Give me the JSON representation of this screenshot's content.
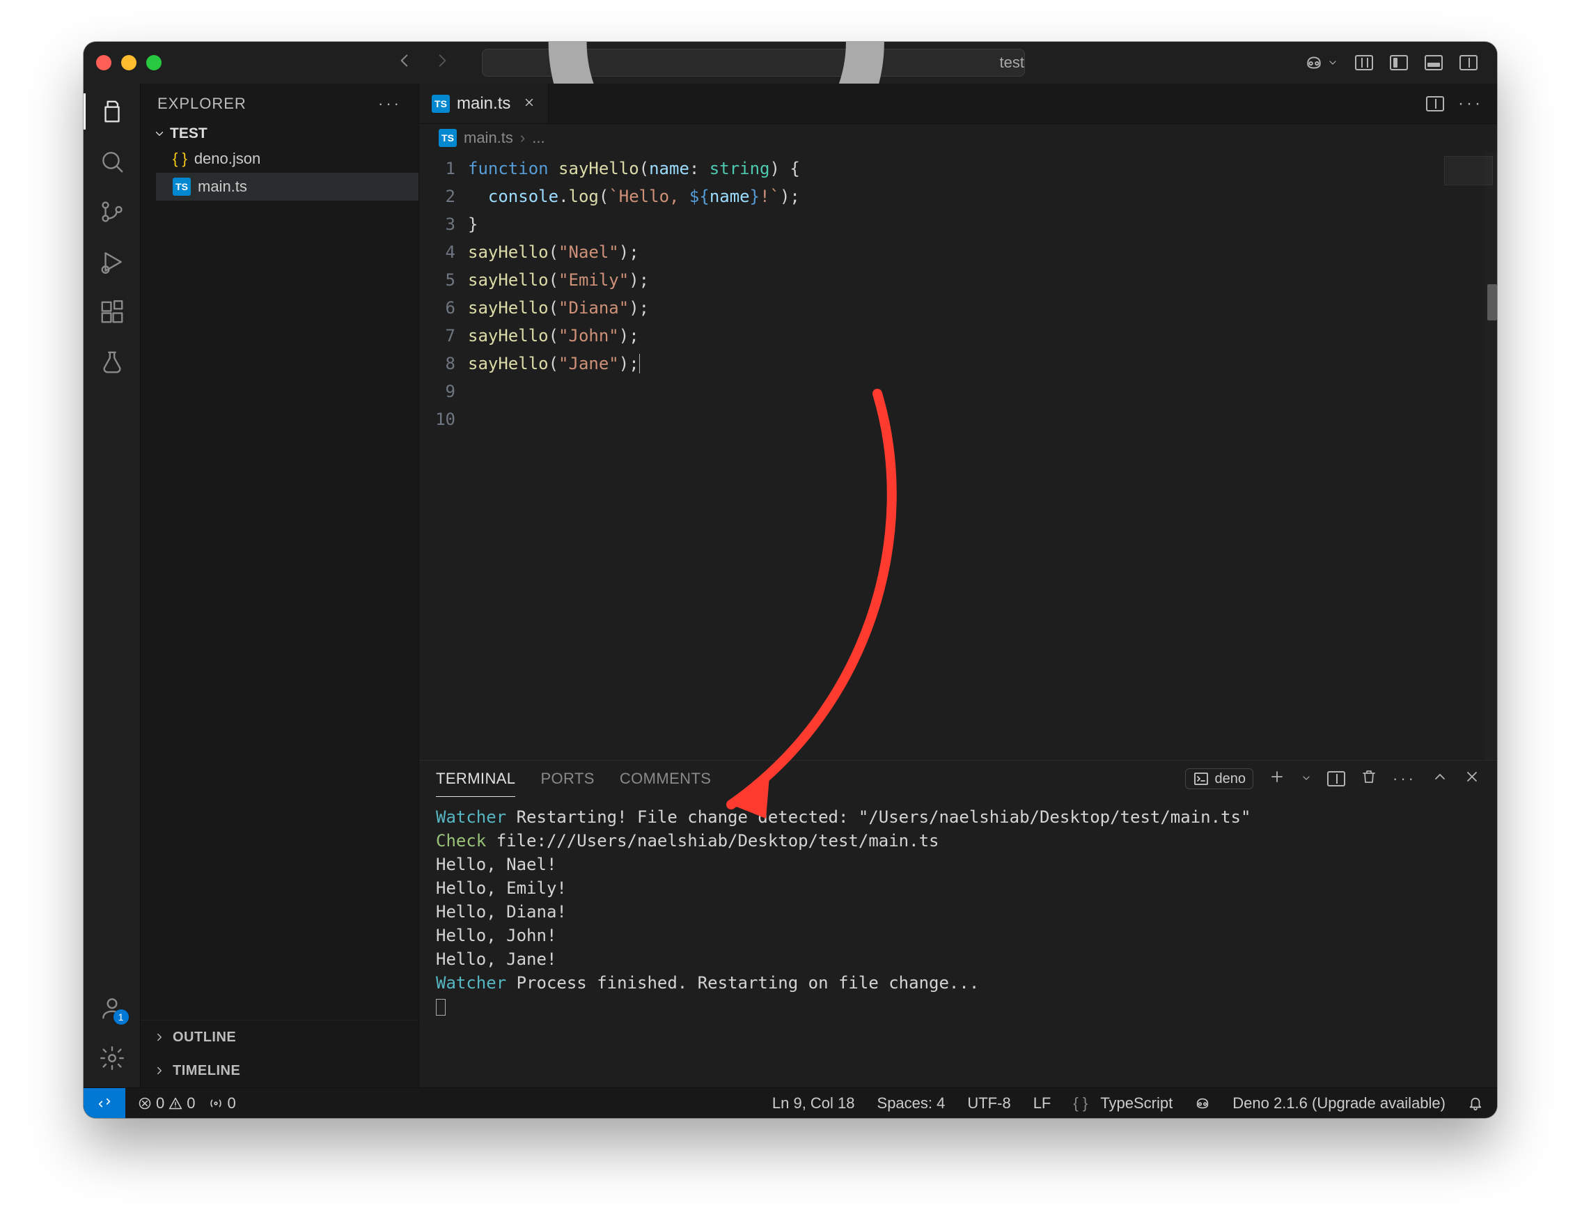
{
  "titlebar": {
    "search_value": "test",
    "copilot_badge": "1"
  },
  "sidebar": {
    "title": "EXPLORER",
    "root_folder": "TEST",
    "files": [
      {
        "icon": "json",
        "name": "deno.json"
      },
      {
        "icon": "ts",
        "name": "main.ts"
      }
    ],
    "outline_label": "OUTLINE",
    "timeline_label": "TIMELINE"
  },
  "tab": {
    "icon": "ts",
    "filename": "main.ts"
  },
  "breadcrumb": {
    "icon": "ts",
    "file": "main.ts",
    "rest": "..."
  },
  "editor": {
    "line_numbers": [
      "1",
      "2",
      "3",
      "4",
      "5",
      "6",
      "7",
      "8",
      "9",
      "10"
    ],
    "code_tokens": [
      [
        {
          "c": "kw",
          "t": "function"
        },
        {
          "c": "",
          "t": " "
        },
        {
          "c": "fn",
          "t": "sayHello"
        },
        {
          "c": "pun",
          "t": "("
        },
        {
          "c": "prm",
          "t": "name"
        },
        {
          "c": "pun",
          "t": ": "
        },
        {
          "c": "typ",
          "t": "string"
        },
        {
          "c": "pun",
          "t": ") {"
        }
      ],
      [
        {
          "c": "",
          "t": "  "
        },
        {
          "c": "obj",
          "t": "console"
        },
        {
          "c": "pun",
          "t": "."
        },
        {
          "c": "fn",
          "t": "log"
        },
        {
          "c": "pun",
          "t": "("
        },
        {
          "c": "str",
          "t": "`Hello, "
        },
        {
          "c": "tmpl",
          "t": "${"
        },
        {
          "c": "prm",
          "t": "name"
        },
        {
          "c": "tmpl",
          "t": "}"
        },
        {
          "c": "str",
          "t": "!`"
        },
        {
          "c": "pun",
          "t": ");"
        }
      ],
      [
        {
          "c": "pun",
          "t": "}"
        }
      ],
      [
        {
          "c": "",
          "t": ""
        }
      ],
      [
        {
          "c": "fn",
          "t": "sayHello"
        },
        {
          "c": "pun",
          "t": "("
        },
        {
          "c": "str",
          "t": "\"Nael\""
        },
        {
          "c": "pun",
          "t": ");"
        }
      ],
      [
        {
          "c": "fn",
          "t": "sayHello"
        },
        {
          "c": "pun",
          "t": "("
        },
        {
          "c": "str",
          "t": "\"Emily\""
        },
        {
          "c": "pun",
          "t": ");"
        }
      ],
      [
        {
          "c": "fn",
          "t": "sayHello"
        },
        {
          "c": "pun",
          "t": "("
        },
        {
          "c": "str",
          "t": "\"Diana\""
        },
        {
          "c": "pun",
          "t": ");"
        }
      ],
      [
        {
          "c": "fn",
          "t": "sayHello"
        },
        {
          "c": "pun",
          "t": "("
        },
        {
          "c": "str",
          "t": "\"John\""
        },
        {
          "c": "pun",
          "t": ");"
        }
      ],
      [
        {
          "c": "fn",
          "t": "sayHello"
        },
        {
          "c": "pun",
          "t": "("
        },
        {
          "c": "str",
          "t": "\"Jane\""
        },
        {
          "c": "pun",
          "t": ");"
        },
        {
          "c": "cur",
          "t": ""
        }
      ],
      [
        {
          "c": "",
          "t": ""
        }
      ]
    ]
  },
  "panel": {
    "tabs": {
      "terminal": "TERMINAL",
      "ports": "PORTS",
      "comments": "COMMENTS"
    },
    "shell_label": "deno",
    "terminal_lines": [
      [
        {
          "c": "watcher",
          "t": "Watcher"
        },
        {
          "c": "",
          "t": " Restarting! File change detected: \"/Users/naelshiab/Desktop/test/main.ts\""
        }
      ],
      [
        {
          "c": "check",
          "t": "Check"
        },
        {
          "c": "",
          "t": " file:///Users/naelshiab/Desktop/test/main.ts"
        }
      ],
      [
        {
          "c": "",
          "t": "Hello, Nael!"
        }
      ],
      [
        {
          "c": "",
          "t": "Hello, Emily!"
        }
      ],
      [
        {
          "c": "",
          "t": "Hello, Diana!"
        }
      ],
      [
        {
          "c": "",
          "t": "Hello, John!"
        }
      ],
      [
        {
          "c": "",
          "t": "Hello, Jane!"
        }
      ],
      [
        {
          "c": "watcher",
          "t": "Watcher"
        },
        {
          "c": "",
          "t": " Process finished. Restarting on file change..."
        }
      ]
    ]
  },
  "status": {
    "errors": "0",
    "warnings": "0",
    "ports": "0",
    "cursor": "Ln 9, Col 18",
    "spaces": "Spaces: 4",
    "encoding": "UTF-8",
    "eol": "LF",
    "language": "TypeScript",
    "deno": "Deno 2.1.6 (Upgrade available)"
  }
}
